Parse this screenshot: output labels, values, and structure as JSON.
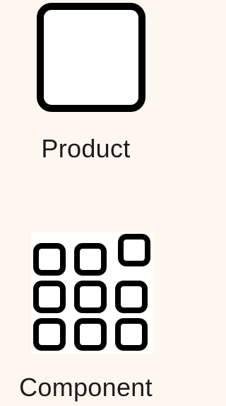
{
  "legend": {
    "items": [
      {
        "id": "product",
        "label": "Product",
        "icon": "single-square-icon"
      },
      {
        "id": "component",
        "label": "Component",
        "icon": "square-grid-icon"
      }
    ]
  },
  "colors": {
    "background": "#fdf7f0",
    "stroke": "#000000",
    "fill": "#ffffff",
    "text": "#1c1c1c"
  }
}
